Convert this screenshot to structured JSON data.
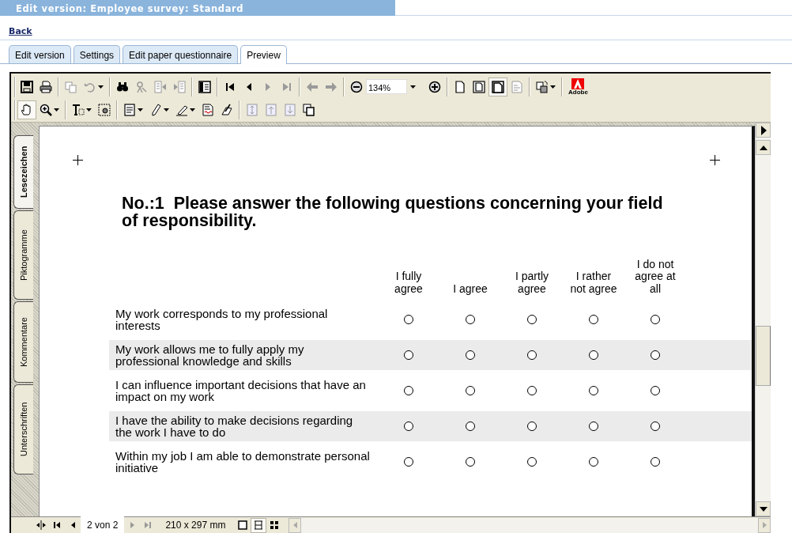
{
  "header": {
    "title": "Edit version: Employee survey: Standard"
  },
  "back_link": "Back",
  "tabs": [
    {
      "label": "Edit version",
      "selected": false
    },
    {
      "label": "Settings",
      "selected": false
    },
    {
      "label": "Edit paper questionnaire",
      "selected": false
    },
    {
      "label": "Preview",
      "selected": true
    }
  ],
  "viewer": {
    "toolbar_rows": [
      [
        {
          "kind": "save",
          "selected": false,
          "disabled": false
        },
        {
          "kind": "print",
          "selected": false,
          "disabled": false
        },
        {
          "kind": "separator"
        },
        {
          "kind": "copy",
          "selected": false,
          "disabled": true
        },
        {
          "kind": "undo",
          "selected": false,
          "disabled": true,
          "dropdown": true
        },
        {
          "kind": "separator"
        },
        {
          "kind": "find",
          "selected": false,
          "disabled": false
        },
        {
          "kind": "search",
          "selected": false,
          "disabled": true
        },
        {
          "kind": "prev_document",
          "selected": false,
          "disabled": true
        },
        {
          "kind": "next_document",
          "selected": false,
          "disabled": true
        },
        {
          "kind": "separator"
        },
        {
          "kind": "pane",
          "selected": false,
          "disabled": false
        },
        {
          "kind": "separator"
        },
        {
          "kind": "first_page",
          "selected": false,
          "disabled": false
        },
        {
          "kind": "prev_page",
          "selected": false,
          "disabled": false
        },
        {
          "kind": "next_page",
          "selected": false,
          "disabled": true
        },
        {
          "kind": "last_page",
          "selected": false,
          "disabled": true
        },
        {
          "kind": "separator"
        },
        {
          "kind": "go_back",
          "selected": false,
          "disabled": true
        },
        {
          "kind": "go_forward",
          "selected": false,
          "disabled": true
        },
        {
          "kind": "separator"
        },
        {
          "kind": "zoom_out",
          "selected": false,
          "disabled": false
        },
        {
          "kind": "zoom_field",
          "value": "134%",
          "dropdown": true
        },
        {
          "kind": "zoom_in",
          "selected": false,
          "disabled": false
        },
        {
          "kind": "separator"
        },
        {
          "kind": "actual_size",
          "selected": false,
          "disabled": false
        },
        {
          "kind": "fit_page",
          "selected": false,
          "disabled": false
        },
        {
          "kind": "fit_width",
          "selected": true,
          "disabled": false
        },
        {
          "kind": "reflow",
          "selected": false,
          "disabled": true
        },
        {
          "kind": "separator"
        },
        {
          "kind": "rotate",
          "selected": false,
          "disabled": false,
          "dropdown": true
        },
        {
          "kind": "separator"
        },
        {
          "kind": "logo",
          "text": "Adobe"
        }
      ],
      [
        {
          "kind": "hand",
          "selected": true,
          "disabled": false
        },
        {
          "kind": "zoom_tool",
          "selected": false,
          "disabled": false,
          "dropdown": true
        },
        {
          "kind": "separator"
        },
        {
          "kind": "text_select",
          "selected": false,
          "disabled": false,
          "dropdown": true
        },
        {
          "kind": "snapshot",
          "selected": false,
          "disabled": false
        },
        {
          "kind": "separator"
        },
        {
          "kind": "note",
          "selected": false,
          "disabled": false,
          "dropdown": true
        },
        {
          "kind": "pencil",
          "selected": false,
          "disabled": false,
          "dropdown": true
        },
        {
          "kind": "highlighter",
          "selected": false,
          "disabled": false,
          "dropdown": true
        },
        {
          "kind": "spellcheck",
          "selected": false,
          "disabled": false
        },
        {
          "kind": "sign",
          "selected": false,
          "disabled": false
        },
        {
          "kind": "separator"
        },
        {
          "kind": "scroll_both",
          "selected": false,
          "disabled": true
        },
        {
          "kind": "scroll_up",
          "selected": false,
          "disabled": true
        },
        {
          "kind": "scroll_down",
          "selected": false,
          "disabled": true
        },
        {
          "kind": "page_stack",
          "selected": false,
          "disabled": false
        }
      ]
    ],
    "side_tabs": [
      {
        "label": "Lesezeichen",
        "selected": true
      },
      {
        "label": "Piktogramme",
        "selected": false
      },
      {
        "label": "Kommentare",
        "selected": false
      },
      {
        "label": "Unterschriften",
        "selected": false
      }
    ],
    "document": {
      "question": "No.:1  Please answer the following questions concerning your field of responsibility.",
      "scale": [
        "I fully agree",
        "I agree",
        "I partly agree",
        "I rather not agree",
        "I do not agree at all"
      ],
      "items": [
        {
          "text": "My work corresponds to my professional interests",
          "answers": [
            {
              "selected": false
            },
            {
              "selected": false
            },
            {
              "selected": false
            },
            {
              "selected": false
            },
            {
              "selected": false
            }
          ]
        },
        {
          "text": "My work allows me to fully apply my professional knowledge and skills",
          "answers": [
            {
              "selected": false
            },
            {
              "selected": false
            },
            {
              "selected": false
            },
            {
              "selected": false
            },
            {
              "selected": false
            }
          ]
        },
        {
          "text": "I can influence important decisions that have an impact on my work",
          "answers": [
            {
              "selected": false
            },
            {
              "selected": false
            },
            {
              "selected": false
            },
            {
              "selected": false
            },
            {
              "selected": false
            }
          ]
        },
        {
          "text": "I have the ability to make decisions regarding the work I have to do",
          "answers": [
            {
              "selected": false
            },
            {
              "selected": false
            },
            {
              "selected": false
            },
            {
              "selected": false
            },
            {
              "selected": false
            }
          ]
        },
        {
          "text": "Within my job I am able to demonstrate personal initiative",
          "answers": [
            {
              "selected": false
            },
            {
              "selected": false
            },
            {
              "selected": false
            },
            {
              "selected": false
            },
            {
              "selected": false
            }
          ]
        }
      ]
    },
    "status_bar": {
      "page": "2 von 2",
      "size": "210 x 297 mm",
      "view_modes": [
        {
          "selected": false
        },
        {
          "selected": true
        },
        {
          "selected": false
        }
      ]
    }
  }
}
